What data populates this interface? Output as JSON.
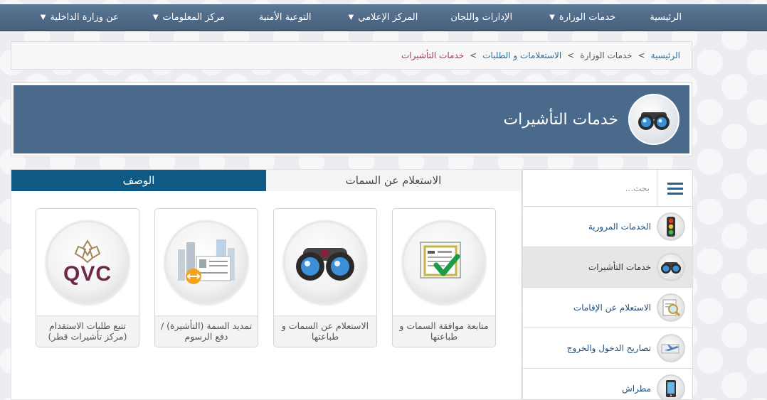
{
  "nav": {
    "items": [
      {
        "label": "الرئيسية",
        "dropdown": false
      },
      {
        "label": "خدمات الوزارة",
        "dropdown": true
      },
      {
        "label": "الإدارات واللجان",
        "dropdown": false
      },
      {
        "label": "المركز الإعلامي",
        "dropdown": true
      },
      {
        "label": "التوعية الأمنية",
        "dropdown": false
      },
      {
        "label": "مركز المعلومات",
        "dropdown": true
      },
      {
        "label": "عن وزارة الداخلية",
        "dropdown": true
      }
    ],
    "caret": "▼"
  },
  "breadcrumb": {
    "home": "الرئيسية",
    "level1": "خدمات الوزارة",
    "level2": "الاستعلامات و الطلبات",
    "current": "خدمات التأشيرات",
    "separator": ">"
  },
  "header": {
    "title": "خدمات التأشيرات",
    "icon": "binoculars-icon"
  },
  "tabs": {
    "inactive": "الاستعلام عن السمات",
    "active": "الوصف"
  },
  "cards": [
    {
      "label": "متابعة موافقة السمات و طباعتها",
      "icon": "approval-document-icon"
    },
    {
      "label": "الاستعلام عن السمات و طباعتها",
      "icon": "binoculars-icon"
    },
    {
      "label": "تمديد السمة (التأشيرة) / دفع الرسوم",
      "icon": "visa-extension-icon"
    },
    {
      "label": "تتبع طلبات الاستقدام (مركز تأشيرات قطر)",
      "icon": "qvc-logo-icon",
      "logo_text": "QVC"
    }
  ],
  "sidebar": {
    "search_placeholder": "بحث...",
    "items": [
      {
        "label": "الخدمات المرورية",
        "icon": "traffic-light-icon",
        "selected": false
      },
      {
        "label": "خدمات التأشيرات",
        "icon": "binoculars-icon",
        "selected": true
      },
      {
        "label": "الاستعلام عن الإقامات",
        "icon": "magnifier-document-icon",
        "selected": false
      },
      {
        "label": "تصاريح الدخول والخروج",
        "icon": "airplane-icon",
        "selected": false
      },
      {
        "label": "مطراش",
        "icon": "metrash-phone-icon",
        "selected": false
      }
    ]
  },
  "colors": {
    "nav_bg": "#4f6a87",
    "banner_bg": "#4a6a8c",
    "active_tab": "#0f5a84",
    "link": "#2a6f9a",
    "breadcrumb_current": "#a2394a",
    "qvc_purple": "#6b2a4a"
  }
}
